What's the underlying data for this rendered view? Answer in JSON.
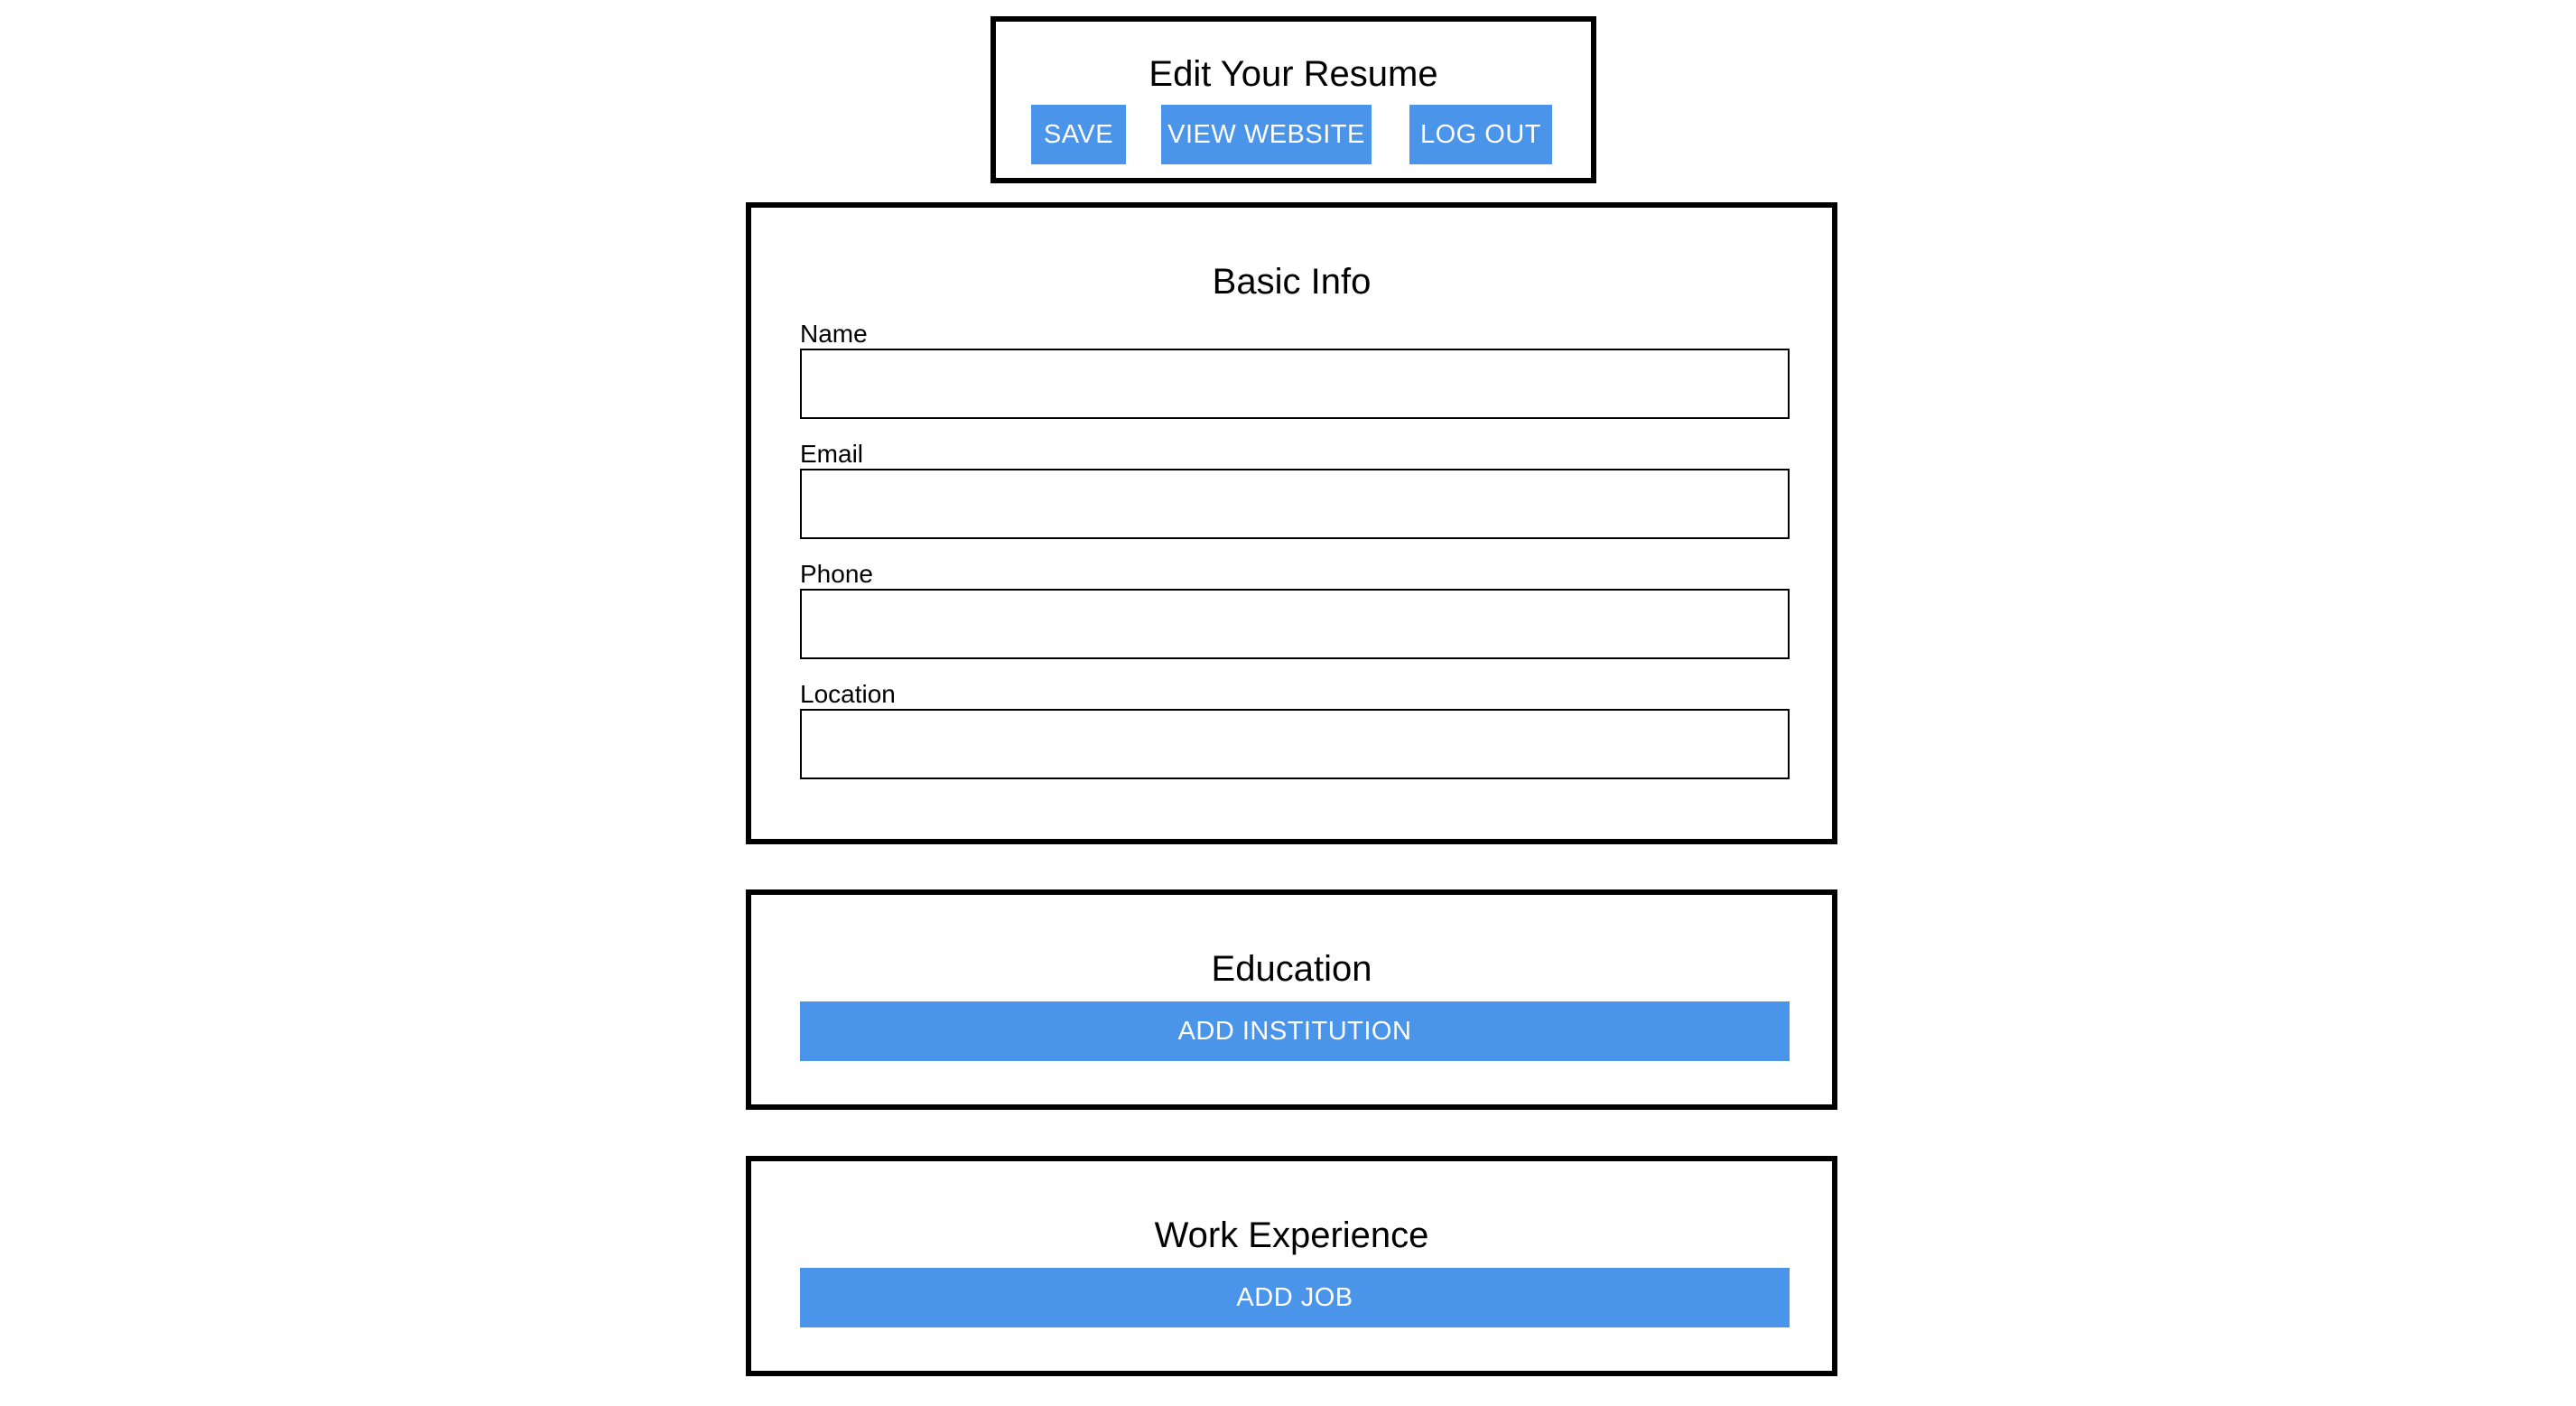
{
  "header": {
    "title": "Edit Your Resume",
    "buttons": {
      "save": "SAVE",
      "view_website": "VIEW WEBSITE",
      "log_out": "LOG OUT"
    }
  },
  "basic_info": {
    "title": "Basic Info",
    "fields": {
      "name": {
        "label": "Name",
        "value": ""
      },
      "email": {
        "label": "Email",
        "value": ""
      },
      "phone": {
        "label": "Phone",
        "value": ""
      },
      "location": {
        "label": "Location",
        "value": ""
      }
    }
  },
  "education": {
    "title": "Education",
    "add_button": "ADD INSTITUTION"
  },
  "work_experience": {
    "title": "Work Experience",
    "add_button": "ADD JOB"
  },
  "colors": {
    "button_background": "#4a94ea",
    "button_text": "#ffffff",
    "border": "#000000",
    "background": "#ffffff"
  }
}
